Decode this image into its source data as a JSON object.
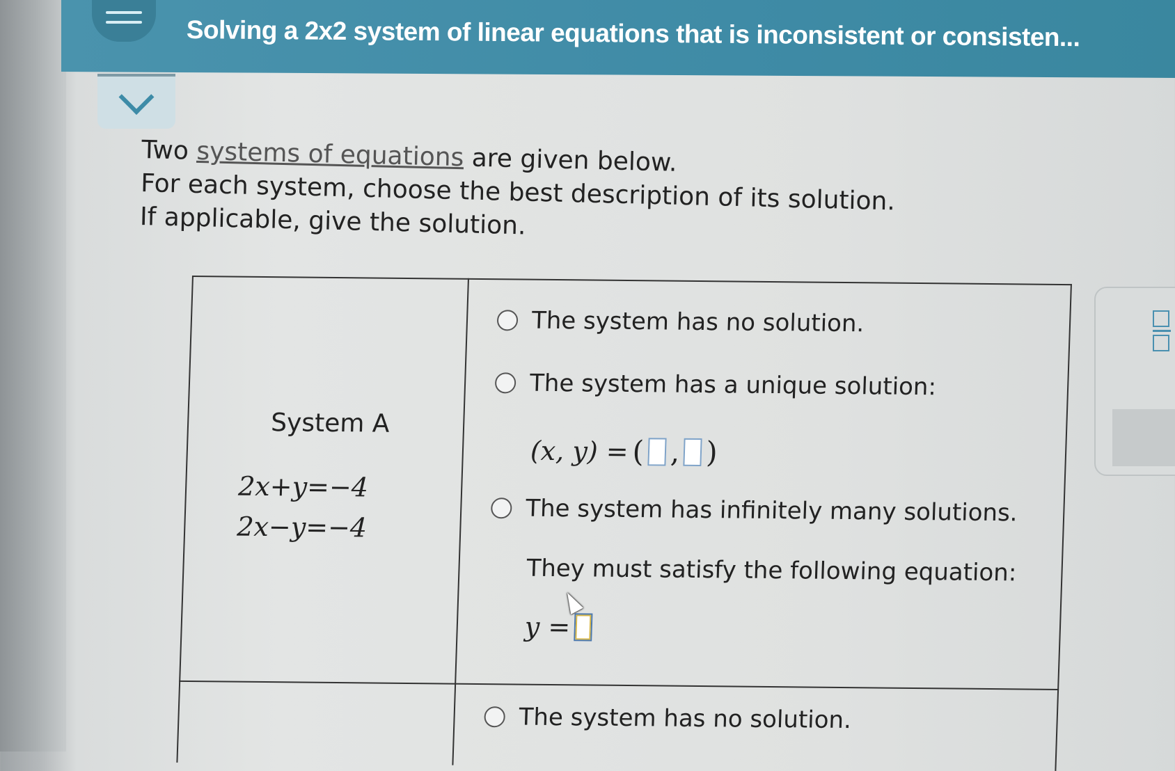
{
  "header": {
    "title": "Solving a 2x2 system of linear equations that is inconsistent or consisten..."
  },
  "instructions": {
    "line1_before": "Two ",
    "line1_link": "systems of equations",
    "line1_after": " are given below.",
    "line2": "For each system, choose the best description of its solution.",
    "line3": "If applicable, give the solution."
  },
  "system_a": {
    "label": "System A",
    "equations": [
      "2x+y=−4",
      "2x−y=−4"
    ],
    "options": {
      "no_solution": "The system has no solution.",
      "unique_solution": "The system has a unique solution:",
      "unique_answer_prefix": "(x, y) =",
      "infinite_solutions": "The system has infinitely many solutions.",
      "must_satisfy": "They must satisfy the following equation:",
      "infinite_answer_prefix": "y ="
    }
  },
  "system_b": {
    "options": {
      "no_solution": "The system has no solution."
    }
  },
  "colors": {
    "header": "#3f8ba6",
    "accent": "#3d8ba7",
    "input_border": "#7fa3c8"
  }
}
